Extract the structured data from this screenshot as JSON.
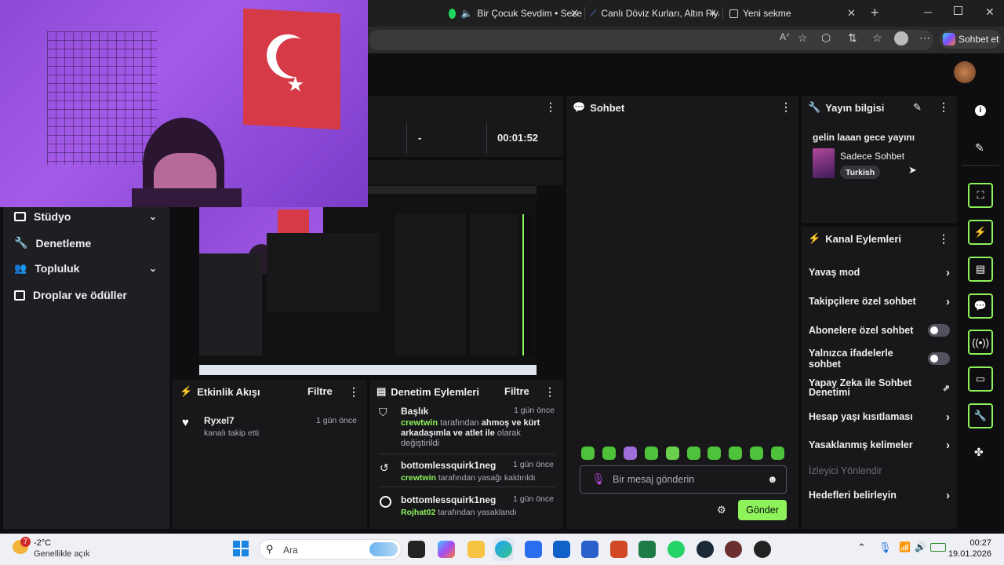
{
  "browser": {
    "tabs": [
      {
        "title": "Bir Çocuk Sevdim • Seze"
      },
      {
        "title": "Canlı Döviz Kurları, Altın Fiyat"
      },
      {
        "title": "Yeni sekme"
      }
    ],
    "chat_button_label": "Sohbet et"
  },
  "sidebar": {
    "items": [
      {
        "label": "Stüdyo"
      },
      {
        "label": "Denetleme"
      },
      {
        "label": "Topluluk"
      },
      {
        "label": "Droplar ve ödüller"
      }
    ]
  },
  "stats": {
    "dash": "-",
    "timer": "00:01:52"
  },
  "activity": {
    "title": "Etkinlik Akışı",
    "filter": "Filtre",
    "items": [
      {
        "user": "Ryxel7",
        "text": "kanalı takip etti",
        "time": "1 gün önce"
      }
    ]
  },
  "modactions": {
    "title": "Denetim Eylemleri",
    "filter": "Filtre",
    "items": [
      {
        "head": "Başlık",
        "time": "1 gün önce",
        "actor": "crewtwin",
        "mid": "tarafından",
        "value": "ahmoş ve kürt arkadaşımla ve atlet ile",
        "tail": "olarak değiştirildi"
      },
      {
        "head": "bottomlessquirk1neg",
        "time": "1 gün önce",
        "actor": "crewtwin",
        "tail": "tarafından yasağı kaldırıldı"
      },
      {
        "head": "bottomlessquirk1neg",
        "time": "1 gün önce",
        "actor": "Rojhat02",
        "tail": "tarafından yasaklandı"
      }
    ]
  },
  "chat": {
    "title": "Sohbet",
    "placeholder": "Bir mesaj gönderin",
    "send": "Gönder"
  },
  "streaminfo": {
    "title": "Yayın bilgisi",
    "stream_title": "gelin laaan gece yayını",
    "category": "Sadece Sohbet",
    "tag": "Turkish"
  },
  "channel_actions": {
    "title": "Kanal Eylemleri",
    "items": [
      {
        "label": "Yavaş mod",
        "control": "chevron"
      },
      {
        "label": "Takipçilere özel sohbet",
        "control": "chevron"
      },
      {
        "label": "Abonelere özel sohbet",
        "control": "toggle"
      },
      {
        "label": "Yalnızca ifadelerle sohbet",
        "control": "toggle"
      },
      {
        "label": "Yapay Zeka ile Sohbet Denetimi",
        "control": "external"
      },
      {
        "label": "Hesap yaşı kısıtlaması",
        "control": "chevron"
      },
      {
        "label": "Yasaklanmış kelimeler",
        "control": "chevron"
      },
      {
        "label": "İzleyici Yönlendir",
        "control": "none"
      },
      {
        "label": "Hedefleri belirleyin",
        "control": "chevron"
      }
    ]
  },
  "taskbar": {
    "weather_temp": "-2°C",
    "weather_desc": "Genellikle açık",
    "weather_badge": "7",
    "search": "Ara",
    "time": "00:27",
    "date": "19.01.2026"
  },
  "colors": {
    "accent_green": "#8ef35a",
    "panel": "#18181b",
    "bg": "#0e0e10"
  }
}
